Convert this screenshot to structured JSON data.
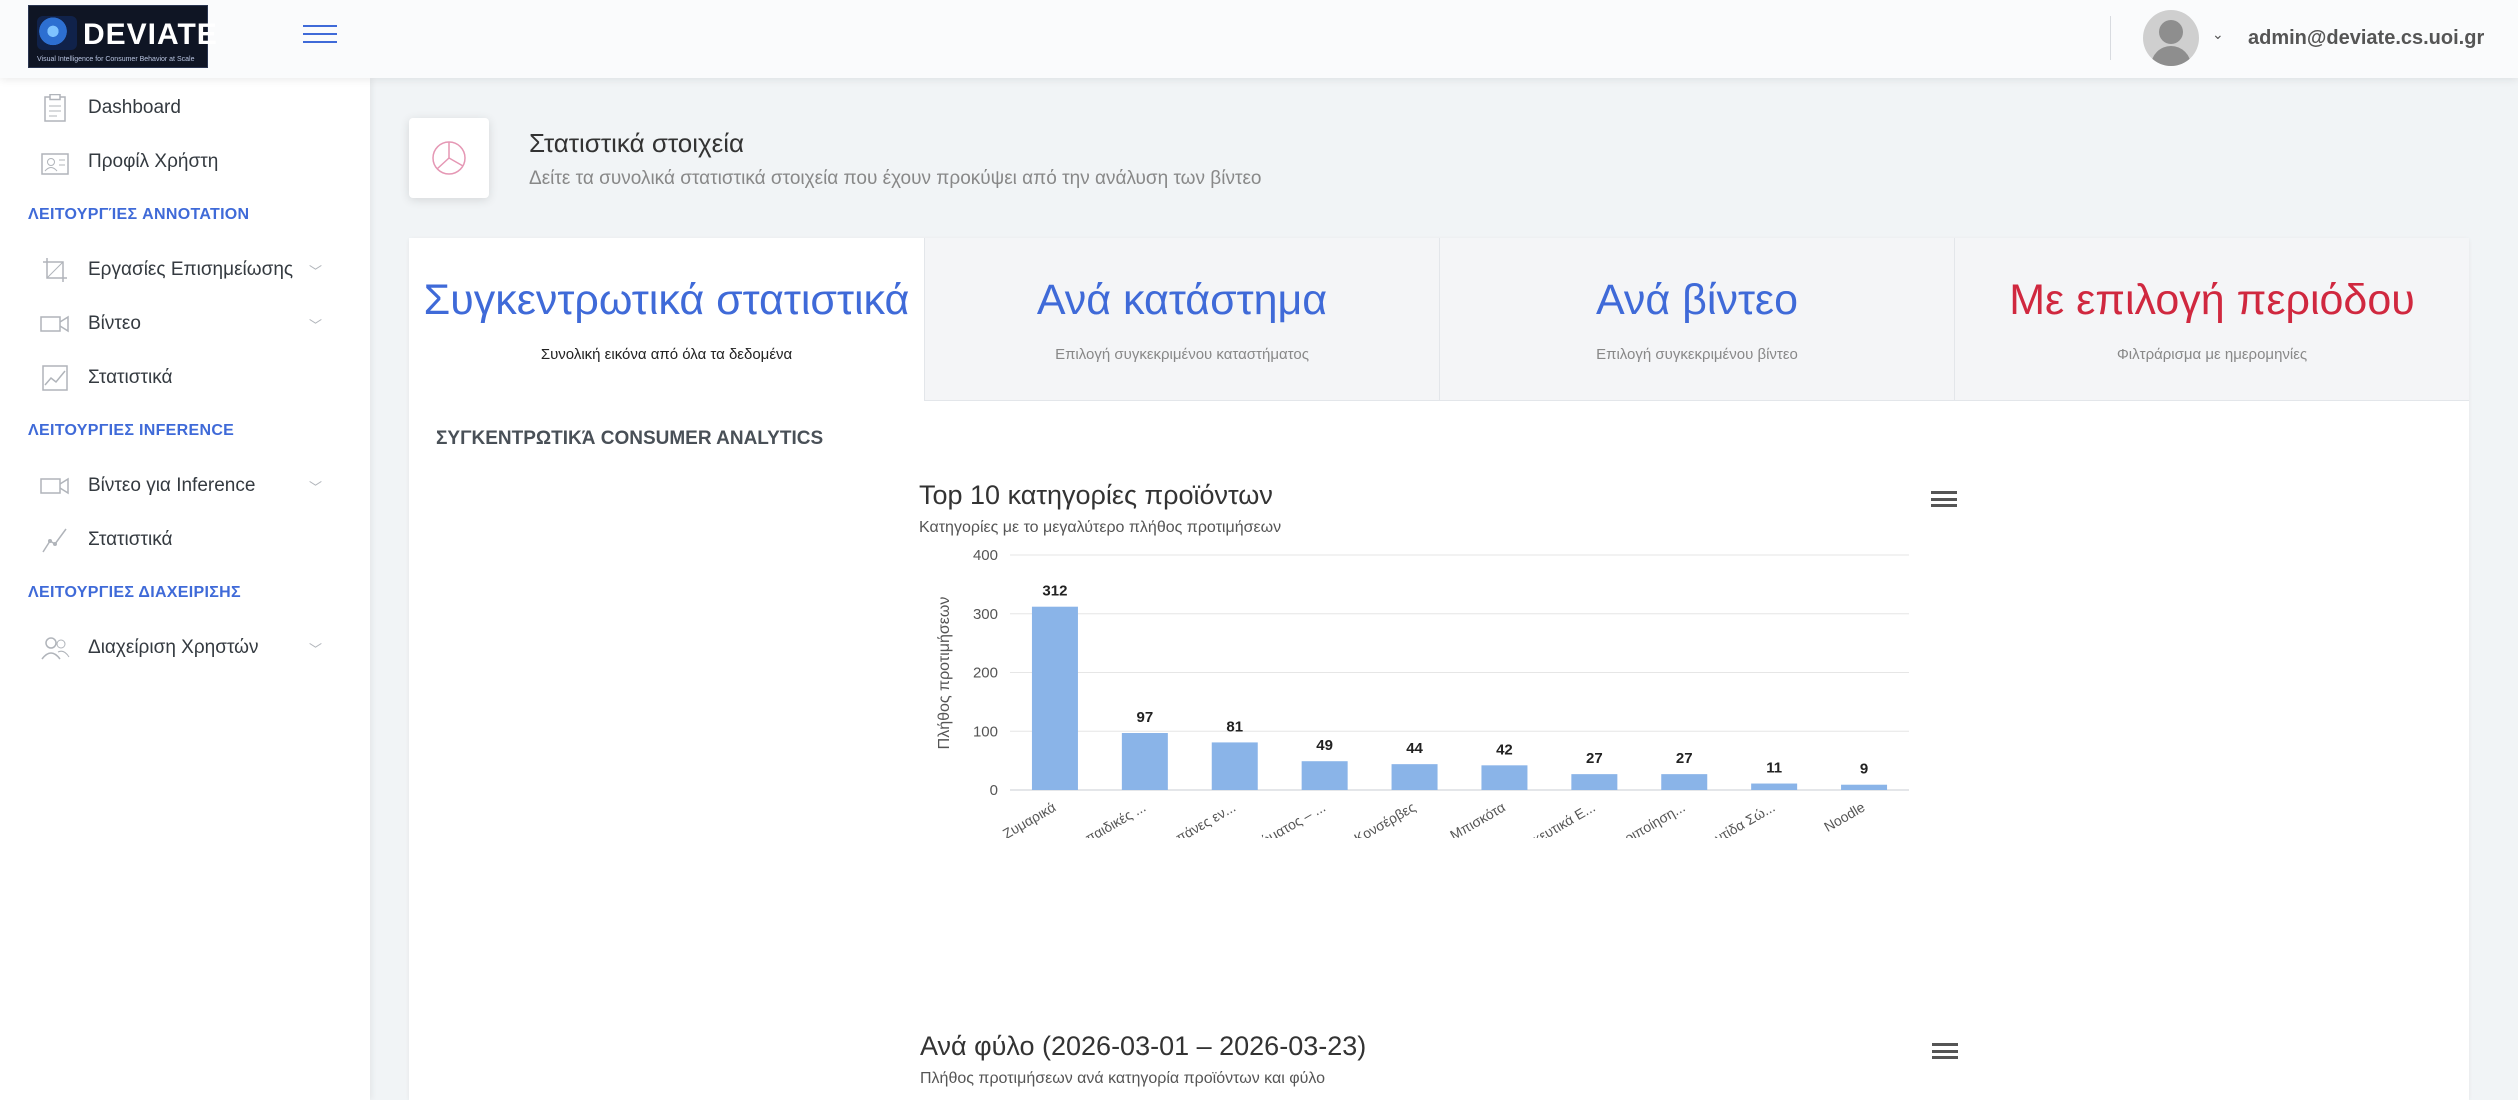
{
  "header": {
    "logo_text": "DEVIATE",
    "logo_subtitle": "Visual Intelligence for Consumer Behavior at Scale",
    "user_email": "admin@deviate.cs.uoi.gr"
  },
  "sidebar": {
    "items": [
      {
        "label": "Dashboard"
      },
      {
        "label": "Προφίλ Χρήστη"
      },
      {
        "label": "Εργασίες Επισημείωσης"
      },
      {
        "label": "Βίντεο"
      },
      {
        "label": "Στατιστικά"
      },
      {
        "label": "Βίντεο για Inference"
      },
      {
        "label": "Στατιστικά"
      },
      {
        "label": "Διαχείριση Χρηστών"
      }
    ],
    "headings": [
      "ΛΕΙΤΟΥΡΓΊΕΣ ANNOTATION",
      "ΛΕΙΤΟΥΡΓΙΕΣ INFERENCE",
      "ΛΕΙΤΟΥΡΓΙΕΣ ΔΙΑΧΕΙΡΙΣΗΣ"
    ]
  },
  "page": {
    "title": "Στατιστικά στοιχεία",
    "subtitle": "Δείτε τα συνολικά στατιστικά στοιχεία που έχουν προκύψει από την ανάλυση των βίντεο"
  },
  "tabs": [
    {
      "title": "Συγκεντρωτικά στατιστικά",
      "subtitle": "Συνολική εικόνα από όλα τα δεδομένα"
    },
    {
      "title": "Ανά κατάστημα",
      "subtitle": "Επιλογή συγκεκριμένου καταστήματος"
    },
    {
      "title": "Ανά βίντεο",
      "subtitle": "Επιλογή συγκεκριμένου βίντεο"
    },
    {
      "title": "Με επιλογή περιόδου",
      "subtitle": "Φιλτράρισμα με ημερομηνίες"
    }
  ],
  "section_title": "ΣΥΓΚΕΝΤΡΩΤΙΚΆ CONSUMER ANALYTICS",
  "chart2": {
    "title": "Ανά φύλο (2026-03-01 – 2026-03-23)",
    "subtitle": "Πλήθος προτιμήσεων ανά κατηγορία προϊόντων και φύλο"
  },
  "colors": {
    "accent": "#3f6ad8",
    "bar": "#8ab4e8",
    "red_tab": "#d0283f"
  },
  "chart_data": {
    "type": "bar",
    "title": "Top 10 κατηγορίες προϊόντων",
    "subtitle": "Κατηγορίες με το μεγαλύτερο πλήθος προτιμήσεων",
    "ylabel": "Πλήθος προτιμήσεων",
    "xlabel": "",
    "ylim": [
      0,
      400
    ],
    "yticks": [
      0,
      100,
      200,
      300,
      400
    ],
    "categories": [
      "Ζυμαρικά",
      "Βρεφικές & παιδικές ...",
      "Σερβιέτες & πάνες εν...",
      "Φροντίδα Σώματος – ...",
      "Κονσέρβες",
      "Μπισκότα",
      "Παραφαρμακευτικά Ε...",
      "Υγιεινή & Περιποίηση...",
      "Βρεφική Φροντίδα Σώ...",
      "Noodle"
    ],
    "values": [
      312,
      97,
      81,
      49,
      44,
      42,
      27,
      27,
      11,
      9
    ],
    "grid": true,
    "legend": "none"
  }
}
